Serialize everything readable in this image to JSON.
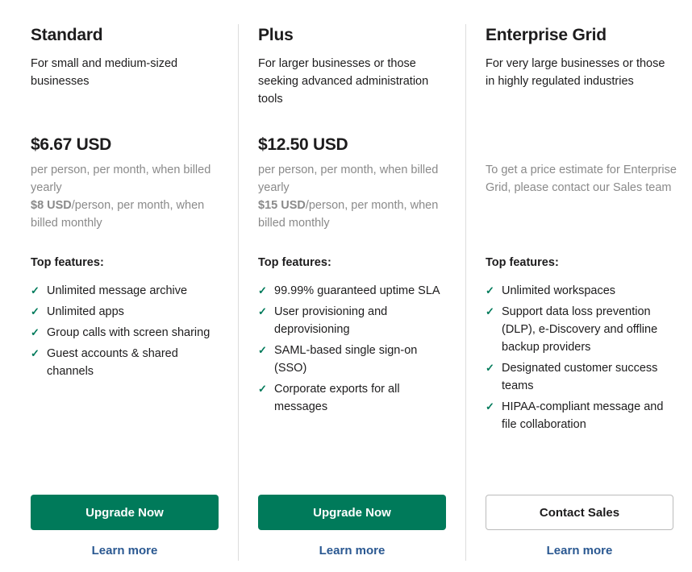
{
  "colors": {
    "primary_green": "#007a5a",
    "link_blue": "#2a5891",
    "muted_gray": "#8a8a8a",
    "text_dark": "#1d1c1d"
  },
  "plans": [
    {
      "name": "Standard",
      "description": "For small and medium-sized businesses",
      "price": "$6.67 USD",
      "price_note_yearly": "per person, per month, when billed yearly",
      "monthly_price": "$8 USD",
      "monthly_note": "/person, per month, when billed monthly",
      "features_title": "Top features:",
      "features": [
        "Unlimited message archive",
        "Unlimited apps",
        "Group calls with screen sharing",
        "Guest accounts & shared channels"
      ],
      "cta_label": "Upgrade Now",
      "learn_more": "Learn more"
    },
    {
      "name": "Plus",
      "description": "For larger businesses or those seeking advanced administration tools",
      "price": "$12.50 USD",
      "price_note_yearly": "per person, per month, when billed yearly",
      "monthly_price": "$15 USD",
      "monthly_note": "/person, per month, when billed monthly",
      "features_title": "Top features:",
      "features": [
        "99.99% guaranteed uptime SLA",
        "User provisioning and deprovisioning",
        "SAML-based single sign-on (SSO)",
        "Corporate exports for all messages"
      ],
      "cta_label": "Upgrade Now",
      "learn_more": "Learn more"
    },
    {
      "name": "Enterprise Grid",
      "description": "For very large businesses or those in highly regulated industries",
      "price_note": "To get a price estimate for Enterprise Grid, please contact our Sales team",
      "features_title": "Top features:",
      "features": [
        "Unlimited workspaces",
        "Support data loss prevention (DLP), e-Discovery and offline backup providers",
        "Designated customer success teams",
        "HIPAA-compliant message and file collaboration"
      ],
      "cta_label": "Contact Sales",
      "learn_more": "Learn more"
    }
  ],
  "icons": {
    "check": "✓"
  }
}
